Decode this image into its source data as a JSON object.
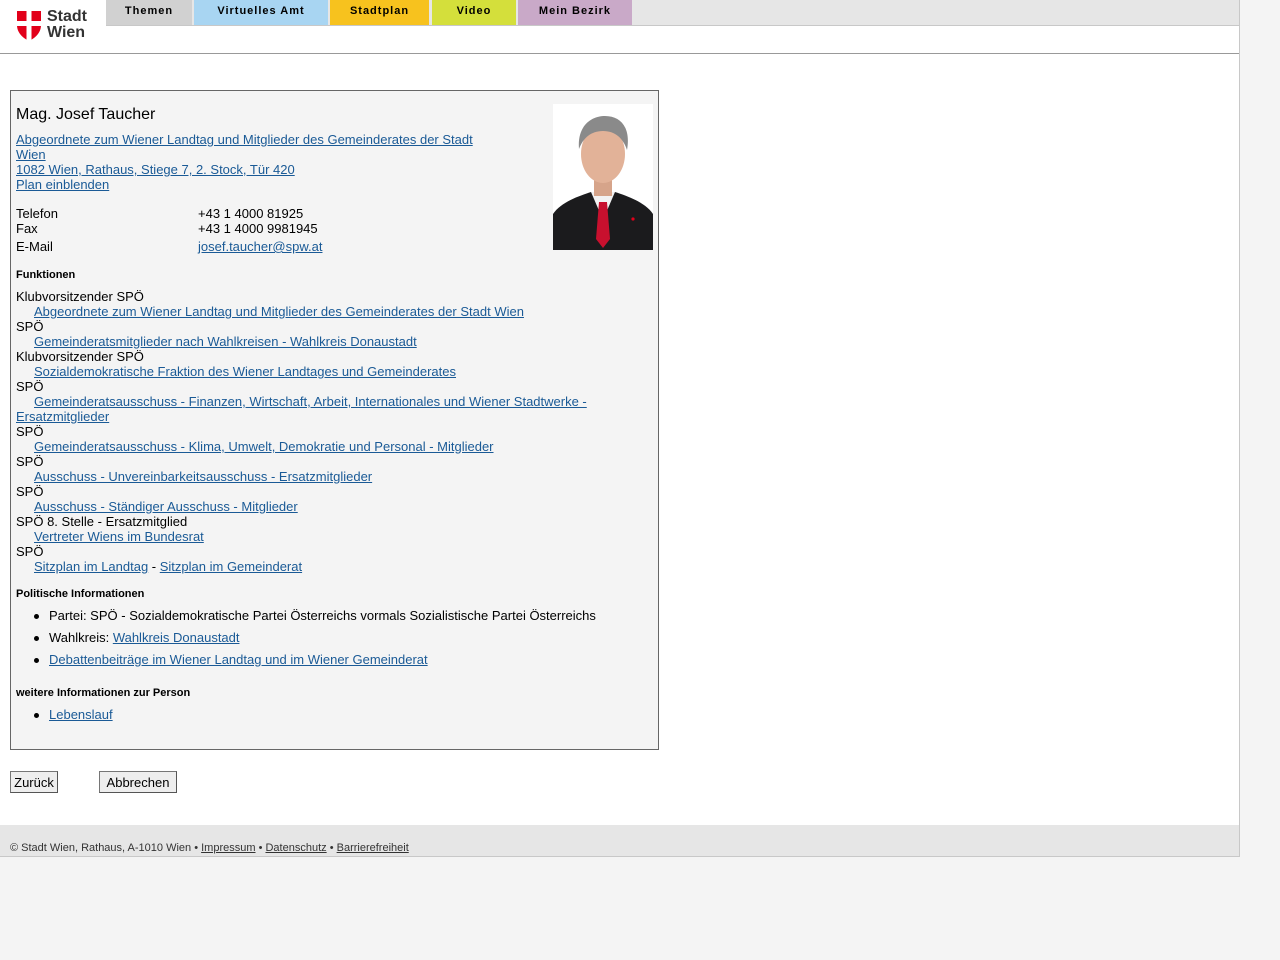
{
  "logo": {
    "line1": "Stadt",
    "line2": "Wien",
    "brand_color": "#e2001a"
  },
  "nav": [
    {
      "label": "Themen",
      "color": "#d1d1d1"
    },
    {
      "label": "Virtuelles Amt",
      "color": "#a8d5f2"
    },
    {
      "label": "Stadtplan",
      "color": "#f7c21e"
    },
    {
      "label": "Video",
      "color": "#d4df3b"
    },
    {
      "label": "Mein Bezirk",
      "color": "#c9a9c8"
    }
  ],
  "person": {
    "name": "Mag. Josef Taucher",
    "affiliation_line1": "Abgeordnete zum Wiener Landtag und Mitglieder des Gemeinderates der Stadt",
    "affiliation_line2": "Wien",
    "address": "1082 Wien, Rathaus, Stiege 7, 2. Stock, Tür 420",
    "plan_link": "Plan einblenden",
    "contacts": [
      {
        "label": "Telefon",
        "value": "+43 1 4000 81925"
      },
      {
        "label": "Fax",
        "value": "+43 1 4000 9981945"
      },
      {
        "label": "E-Mail",
        "value": "josef.taucher@spw.at"
      }
    ]
  },
  "functions": {
    "heading": "Funktionen",
    "items": [
      {
        "role": "Klubvorsitzender SPÖ",
        "link": "Abgeordnete zum Wiener Landtag und Mitglieder des Gemeinderates der Stadt Wien"
      },
      {
        "role": "SPÖ",
        "link": "Gemeinderatsmitglieder nach Wahlkreisen - Wahlkreis Donaustadt"
      },
      {
        "role": "Klubvorsitzender SPÖ",
        "link": "Sozialdemokratische Fraktion des Wiener Landtages und Gemeinderates"
      },
      {
        "role": "SPÖ",
        "link": "Gemeinderatsausschuss - Finanzen, Wirtschaft, Arbeit, Internationales und Wiener Stadtwerke -",
        "link_cont": "Ersatzmitglieder"
      },
      {
        "role": "SPÖ",
        "link": "Gemeinderatsausschuss - Klima, Umwelt, Demokratie und Personal - Mitglieder"
      },
      {
        "role": "SPÖ",
        "link": "Ausschuss - Unvereinbarkeitsausschuss - Ersatzmitglieder"
      },
      {
        "role": "SPÖ",
        "link": "Ausschuss - Ständiger Ausschuss - Mitglieder"
      },
      {
        "role": "SPÖ 8. Stelle - Ersatzmitglied",
        "link": "Vertreter Wiens im Bundesrat"
      },
      {
        "role": "SPÖ",
        "link": "Sitzplan im Landtag",
        "separator": " - ",
        "link2": "Sitzplan im Gemeinderat"
      }
    ]
  },
  "political": {
    "heading": "Politische Informationen",
    "party": "Partei: SPÖ - Sozialdemokratische Partei Österreichs vormals Sozialistische Partei Österreichs",
    "district_label": "Wahlkreis: ",
    "district_link": "Wahlkreis Donaustadt",
    "debates_link": "Debattenbeiträge im Wiener Landtag und im Wiener Gemeinderat"
  },
  "further": {
    "heading": "weitere Informationen zur Person",
    "cv_link": "Lebenslauf"
  },
  "buttons": {
    "back": "Zurück",
    "cancel": "Abbrechen"
  },
  "footer": {
    "copyright": "© Stadt Wien, Rathaus, A-1010 Wien • ",
    "impressum": "Impressum",
    "sep": " • ",
    "datenschutz": "Datenschutz",
    "barrierefreiheit": "Barrierefreiheit"
  }
}
